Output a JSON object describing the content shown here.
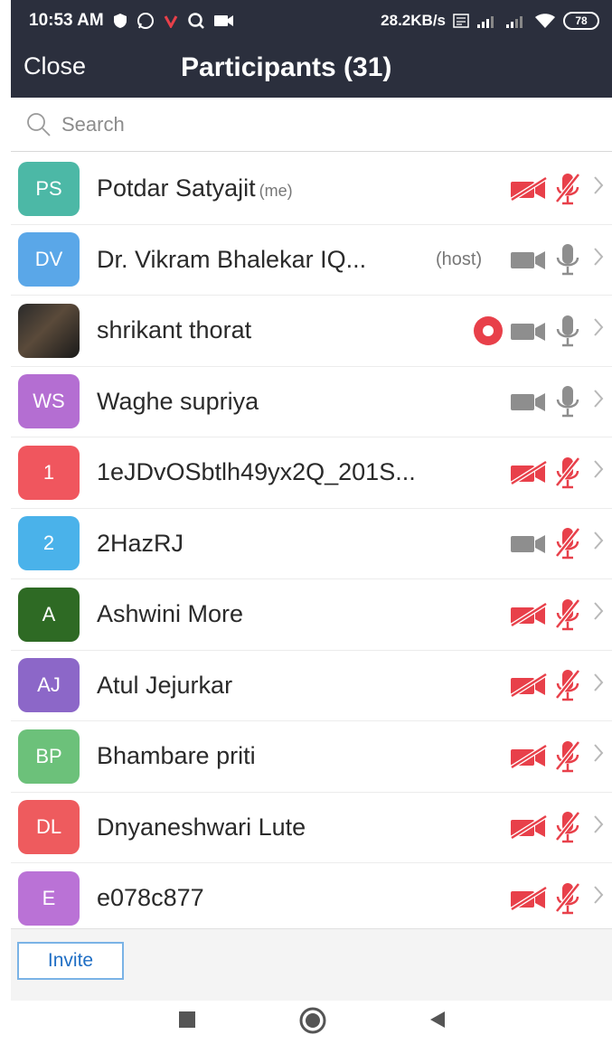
{
  "status_bar": {
    "time": "10:53 AM",
    "net_speed": "28.2KB/s",
    "battery": "78",
    "icons": [
      "shield-icon",
      "whatsapp-icon",
      "vivaldi-icon",
      "search-icon",
      "video-record-icon",
      "lte-icon",
      "signal-icon",
      "signal-icon-2",
      "wifi-icon",
      "battery-icon"
    ]
  },
  "nav": {
    "close_label": "Close",
    "title": "Participants (31)"
  },
  "search": {
    "placeholder": "Search",
    "value": ""
  },
  "participants": [
    {
      "initials": "PS",
      "name": "Potdar Satyajit",
      "tag": "(me)",
      "host_tag": "",
      "color": "#4cb8a6",
      "video": "off",
      "audio": "muted",
      "recording": false,
      "photo": false
    },
    {
      "initials": "DV",
      "name": "Dr. Vikram Bhalekar IQ...",
      "tag": "",
      "host_tag": "(host)",
      "color": "#5aa7e8",
      "video": "on",
      "audio": "on",
      "recording": false,
      "photo": false
    },
    {
      "initials": "",
      "name": "shrikant thorat",
      "tag": "",
      "host_tag": "",
      "color": "#3a3a3a",
      "video": "on",
      "audio": "on",
      "recording": true,
      "photo": true
    },
    {
      "initials": "WS",
      "name": "Waghe supriya",
      "tag": "",
      "host_tag": "",
      "color": "#b46ed2",
      "video": "on",
      "audio": "on",
      "recording": false,
      "photo": false
    },
    {
      "initials": "1",
      "name": "1eJDvOSbtlh49yx2Q_201S...",
      "tag": "",
      "host_tag": "",
      "color": "#f0565e",
      "video": "off",
      "audio": "muted",
      "recording": false,
      "photo": false
    },
    {
      "initials": "2",
      "name": "2HazRJ",
      "tag": "",
      "host_tag": "",
      "color": "#4ab2ea",
      "video": "on",
      "audio": "muted",
      "recording": false,
      "photo": false
    },
    {
      "initials": "A",
      "name": "Ashwini More",
      "tag": "",
      "host_tag": "",
      "color": "#2e6a24",
      "video": "off",
      "audio": "muted",
      "recording": false,
      "photo": false
    },
    {
      "initials": "AJ",
      "name": "Atul Jejurkar",
      "tag": "",
      "host_tag": "",
      "color": "#8c67c8",
      "video": "off",
      "audio": "muted",
      "recording": false,
      "photo": false
    },
    {
      "initials": "BP",
      "name": "Bhambare priti",
      "tag": "",
      "host_tag": "",
      "color": "#6cc17a",
      "video": "off",
      "audio": "muted",
      "recording": false,
      "photo": false
    },
    {
      "initials": "DL",
      "name": "Dnyaneshwari Lute",
      "tag": "",
      "host_tag": "",
      "color": "#ee5b5e",
      "video": "off",
      "audio": "muted",
      "recording": false,
      "photo": false
    },
    {
      "initials": "E",
      "name": "e078c877",
      "tag": "",
      "host_tag": "",
      "color": "#ba72d6",
      "video": "off",
      "audio": "muted",
      "recording": false,
      "photo": false
    }
  ],
  "footer": {
    "invite_label": "Invite"
  },
  "system_nav": {
    "icons": [
      "recents-square-icon",
      "home-circle-icon",
      "back-triangle-icon"
    ]
  },
  "colors": {
    "header_bg": "#2b2f3d",
    "muted_red": "#e8404a",
    "icon_gray": "#8e8e8e",
    "invite_blue": "#1f6ec4"
  }
}
